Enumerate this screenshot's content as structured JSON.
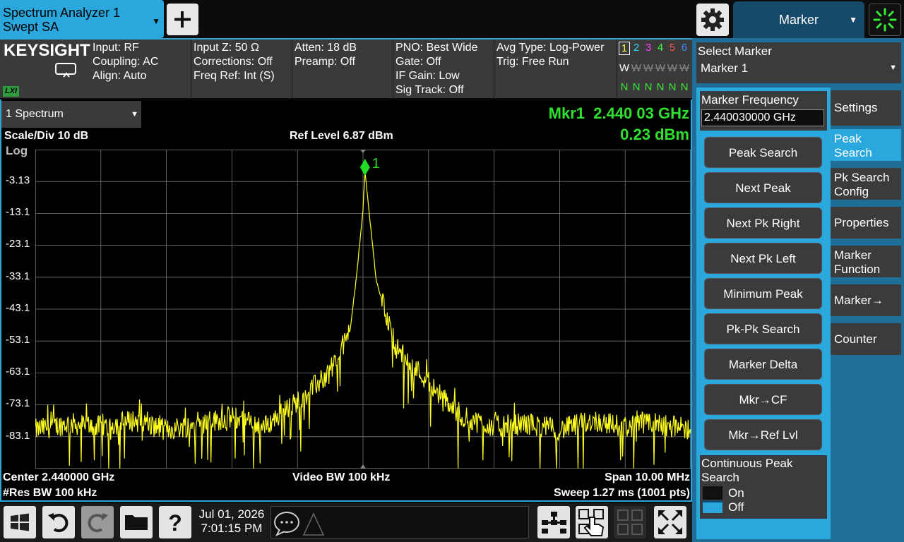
{
  "window": {
    "title_line1": "Spectrum Analyzer 1",
    "title_line2": "Swept SA"
  },
  "icons": {
    "add": "plus-icon",
    "settings": "gear-icon",
    "status": "activity-spinner-icon"
  },
  "colors": {
    "accent": "#2aa7dd",
    "trace": "#ffff20",
    "marker": "#22dd22",
    "readout": "#2fe22f",
    "panel": "#3b3b3b"
  },
  "top_menu": {
    "label": "Marker"
  },
  "brand": {
    "name": "KEYSIGHT",
    "lxi": "LXI"
  },
  "info": {
    "col1": [
      "Input: RF",
      "Coupling: AC",
      "Align: Auto"
    ],
    "col2": [
      "Input Z: 50 Ω",
      "Corrections: Off",
      "Freq Ref: Int (S)"
    ],
    "col3": [
      "Atten: 18 dB",
      "Preamp: Off"
    ],
    "col4": [
      "PNO: Best Wide",
      "Gate: Off",
      "IF Gain: Low",
      "Sig Track: Off"
    ],
    "col5": [
      "Avg Type: Log-Power",
      "Trig: Free Run"
    ]
  },
  "traces": {
    "numbers": [
      "1",
      "2",
      "3",
      "4",
      "5",
      "6"
    ],
    "types": [
      "W",
      "W",
      "W",
      "W",
      "W",
      "W"
    ],
    "detectors": [
      "N",
      "N",
      "N",
      "N",
      "N",
      "N"
    ],
    "number_colors": [
      "#ffff40",
      "#33d6ff",
      "#ff44ff",
      "#44ff44",
      "#ff5555",
      "#4488ff"
    ]
  },
  "select_marker": {
    "label": "Select Marker",
    "value": "Marker 1"
  },
  "window_select": {
    "value": "1 Spectrum"
  },
  "readout": {
    "marker_freq": "Mkr1  2.440 03 GHz",
    "marker_amp": "0.23 dBm"
  },
  "scale": {
    "scale_div": "Scale/Div 10 dB",
    "ref_level": "Ref Level 6.87 dBm",
    "log": "Log"
  },
  "bottom": {
    "center": "Center 2.440000 GHz",
    "res_bw": "#Res BW 100 kHz",
    "video_bw": "Video BW 100 kHz",
    "span": "Span 10.00 MHz",
    "sweep": "Sweep 1.27 ms (1001 pts)"
  },
  "marker_label": "1",
  "chart_data": {
    "type": "line",
    "y_ticks": [
      "-3.13",
      "-13.1",
      "-23.1",
      "-33.1",
      "-43.1",
      "-53.1",
      "-63.1",
      "-73.1",
      "-83.1"
    ],
    "ylim": [
      -93.13,
      6.87
    ],
    "xlim_ghz": [
      2.435,
      2.445
    ],
    "peak": {
      "x_ghz": 2.44003,
      "y_dbm": 0.23
    },
    "noise_floor_dbm": -80,
    "grid": true,
    "x_ghz": [
      2.435,
      2.4355,
      2.436,
      2.4365,
      2.437,
      2.4375,
      2.438,
      2.4385,
      2.439,
      2.4395,
      2.4398,
      2.4399,
      2.44,
      2.44003,
      2.4401,
      2.4402,
      2.4405,
      2.441,
      2.4415,
      2.442,
      2.4425,
      2.443,
      2.4435,
      2.444,
      2.4445,
      2.445
    ],
    "y_dbm": [
      -81,
      -79,
      -80,
      -78,
      -81,
      -79,
      -77,
      -80,
      -72,
      -63,
      -50,
      -33,
      -12,
      0.23,
      -14,
      -34,
      -55,
      -66,
      -77,
      -80,
      -79,
      -81,
      -78,
      -80,
      -79,
      -81
    ]
  },
  "softkeys": [
    "Peak Search",
    "Next Peak",
    "Next Pk Right",
    "Next Pk Left",
    "Minimum Peak",
    "Pk-Pk Search",
    "Marker Delta",
    "Mkr→CF",
    "Mkr→Ref Lvl"
  ],
  "marker_frequency": {
    "label": "Marker Frequency",
    "value": "2.440030000 GHz"
  },
  "continuous": {
    "label_line1": "Continuous Peak",
    "label_line2": "Search",
    "on": "On",
    "off": "Off",
    "state": "Off"
  },
  "tabs": [
    {
      "line1": "Settings",
      "line2": ""
    },
    {
      "line1": "Peak",
      "line2": "Search"
    },
    {
      "line1": "Pk Search",
      "line2": "Config"
    },
    {
      "line1": "Properties",
      "line2": ""
    },
    {
      "line1": "Marker",
      "line2": "Function"
    },
    {
      "line1": "Marker→",
      "line2": ""
    },
    {
      "line1": "Counter",
      "line2": ""
    }
  ],
  "taskbar": {
    "date": "Jul 01, 2026",
    "time": "7:01:15 PM"
  }
}
